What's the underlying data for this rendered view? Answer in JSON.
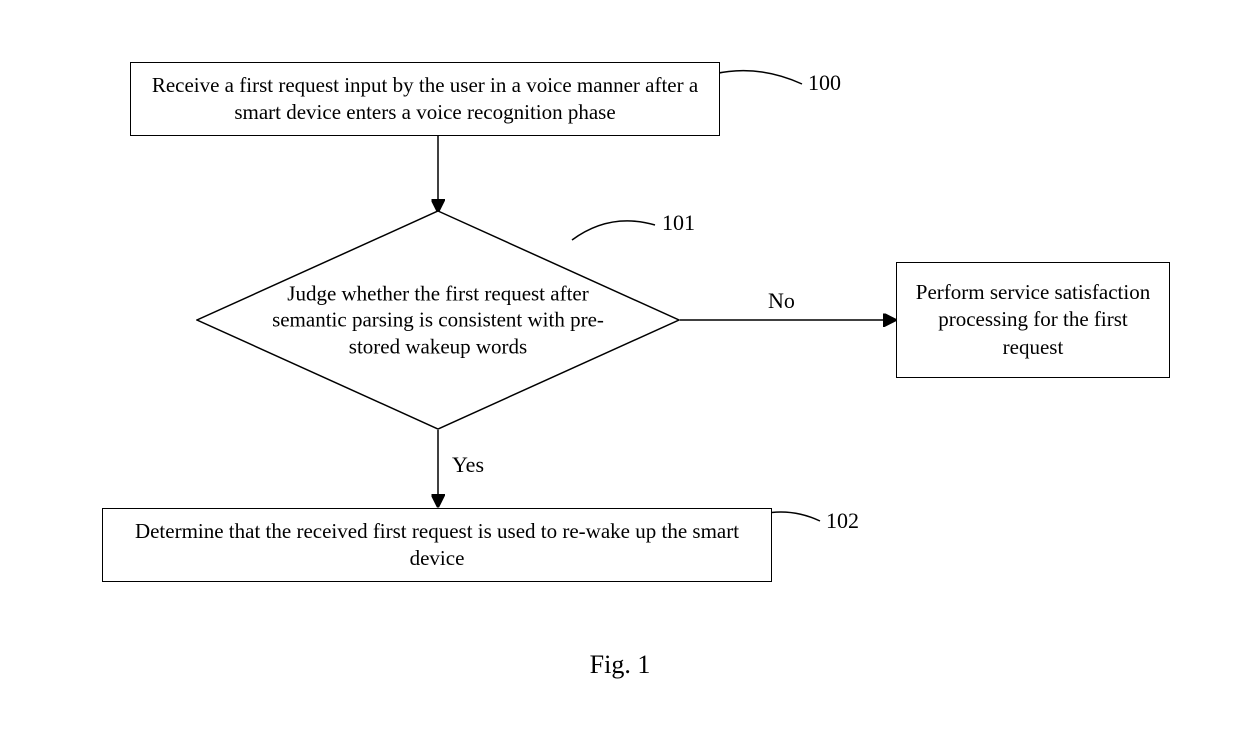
{
  "nodes": {
    "step100": {
      "text": "Receive a first request input by the user in a voice manner after a smart device enters a voice recognition phase",
      "ref": "100"
    },
    "decision101": {
      "text": "Judge whether the first request after semantic parsing is consistent with pre-stored wakeup words",
      "ref": "101"
    },
    "perform": {
      "text": "Perform service satisfaction processing for the first request"
    },
    "step102": {
      "text": "Determine that the received first request is used to re-wake up the smart device",
      "ref": "102"
    }
  },
  "edges": {
    "yes": "Yes",
    "no": "No"
  },
  "figure": "Fig. 1"
}
